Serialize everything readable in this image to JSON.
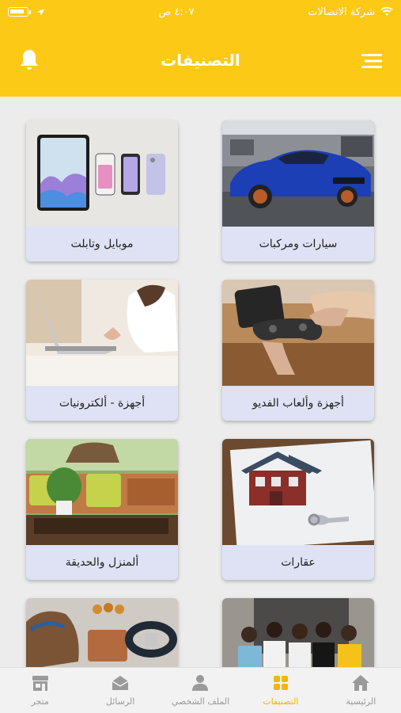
{
  "status_bar": {
    "carrier": "شركة الاتصالات",
    "time": "٤:٠٧ ص"
  },
  "header": {
    "title": "التصنيفات"
  },
  "categories": [
    {
      "label": "سيارات ومركبات"
    },
    {
      "label": "موبايل وتابلت"
    },
    {
      "label": "أجهزة وألعاب الفديو"
    },
    {
      "label": "أجهزة - ألكترونيات"
    },
    {
      "label": "عقارات"
    },
    {
      "label": "ألمنزل والحديقة"
    }
  ],
  "tabs": [
    {
      "label": "الرئيسية",
      "icon": "home-icon"
    },
    {
      "label": "التصنيفات",
      "icon": "grid-icon",
      "active": true
    },
    {
      "label": "الملف الشخصي",
      "icon": "profile-icon"
    },
    {
      "label": "الرسائل",
      "icon": "messages-icon"
    },
    {
      "label": "متجر",
      "icon": "store-icon"
    }
  ],
  "colors": {
    "brand": "#fcc917",
    "active_tab": "#f2b705",
    "card_label_bg": "#dfe2f5"
  }
}
